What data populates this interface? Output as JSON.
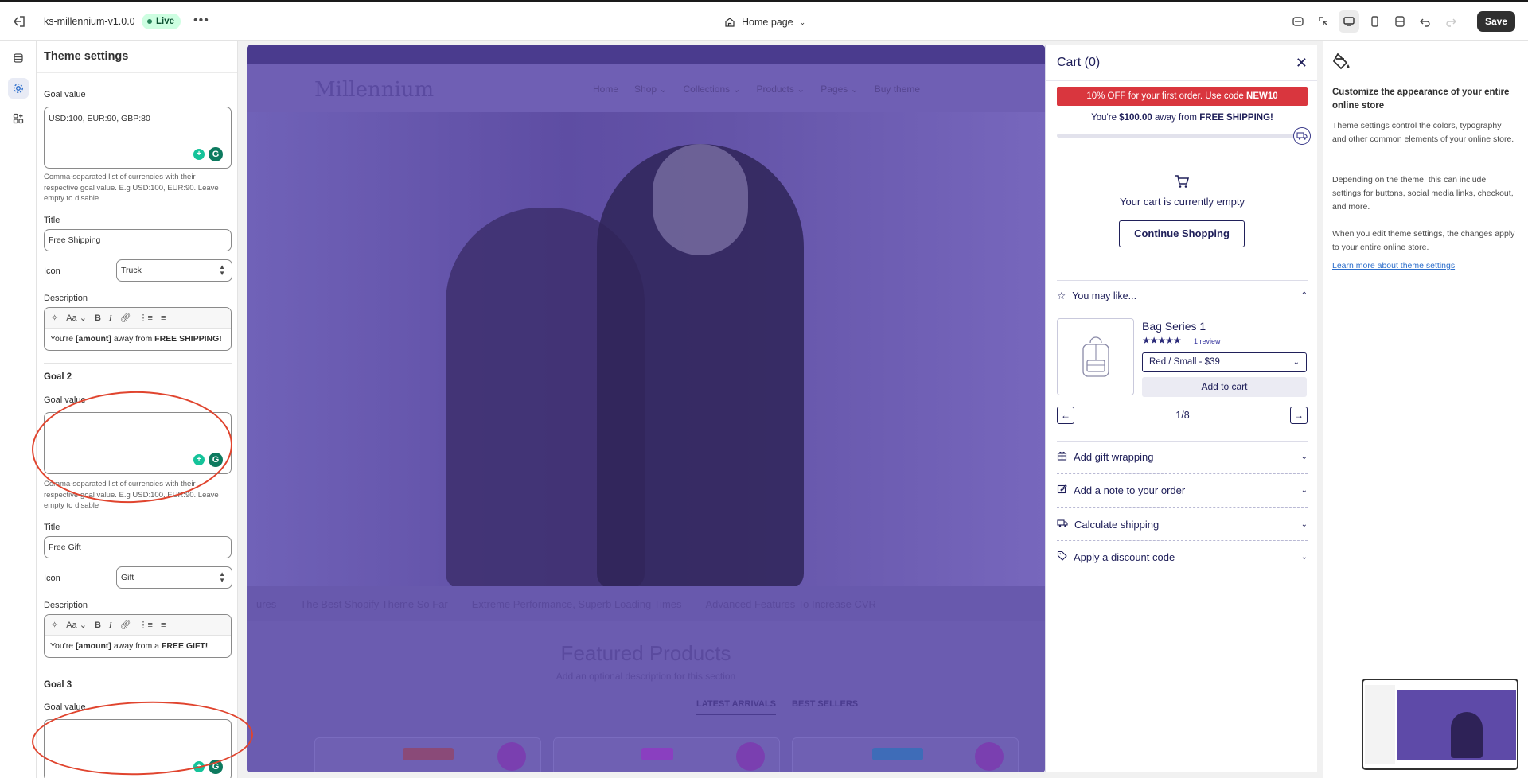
{
  "topbar": {
    "theme_name": "ks-millennium-v1.0.0",
    "status_badge": "Live",
    "page_selector": "Home page",
    "save_label": "Save"
  },
  "settings": {
    "title": "Theme settings",
    "goal_value_label": "Goal value",
    "goal1": {
      "goal_value": "USD:100, EUR:90, GBP:80",
      "help": "Comma-separated list of currencies with their respective goal value. E.g USD:100, EUR:90. Leave empty to disable",
      "title_label": "Title",
      "title_value": "Free Shipping",
      "icon_label": "Icon",
      "icon_value": "Truck",
      "description_label": "Description",
      "description_prefix": "You're ",
      "description_amount": "[amount]",
      "description_suffix": " away from ",
      "description_bold": "FREE SHIPPING!"
    },
    "goal2": {
      "heading": "Goal 2",
      "goal_value_label": "Goal value",
      "goal_value": "",
      "help": "Comma-separated list of currencies with their respective goal value. E.g USD:100, EUR:90. Leave empty to disable",
      "title_label": "Title",
      "title_value": "Free Gift",
      "icon_label": "Icon",
      "icon_value": "Gift",
      "description_label": "Description",
      "description_prefix": "You're ",
      "description_amount": "[amount]",
      "description_suffix": " away from a ",
      "description_bold": "FREE GIFT!"
    },
    "goal3": {
      "heading": "Goal 3",
      "goal_value_label": "Goal value",
      "goal_value": ""
    }
  },
  "preview": {
    "logo": "Millennium",
    "nav": [
      "Home",
      "Shop ⌄",
      "Collections ⌄",
      "Products ⌄",
      "Pages ⌄",
      "Buy theme"
    ],
    "marquee": [
      "ures",
      "The Best Shopify Theme So Far",
      "Extreme Performance, Superb Loading Times",
      "Advanced Features To Increase CVR"
    ],
    "featured_title": "Featured Products",
    "featured_sub": "Add an optional description for this section",
    "tabs": [
      "LATEST ARRIVALS",
      "BEST SELLERS"
    ]
  },
  "cart": {
    "title": "Cart (0)",
    "promo_text": "10% OFF for your first order. Use code ",
    "promo_code": "NEW10",
    "ship_prefix": "You're ",
    "ship_amount": "$100.00",
    "ship_middle": " away from ",
    "ship_goal": "FREE SHIPPING!",
    "progress": 0,
    "empty_text": "Your cart is currently empty",
    "continue_label": "Continue Shopping",
    "you_may_like": "You may like...",
    "product": {
      "name": "Bag Series 1",
      "stars": "★★★★★",
      "reviews": "1 review",
      "variant": "Red / Small - $39",
      "add_label": "Add to cart"
    },
    "pagination": "1/8",
    "accordions": [
      "Add gift wrapping",
      "Add a note to your order",
      "Calculate shipping",
      "Apply a discount code"
    ]
  },
  "info": {
    "heading": "Customize the appearance of your entire online store",
    "p1": "Theme settings control the colors, typography and other common elements of your online store.",
    "p2": "Depending on the theme, this can include settings for buttons, social media links, checkout, and more.",
    "p3": "When you edit theme settings, the changes apply to your entire online store.",
    "link": "Learn more about theme settings"
  },
  "colors": {
    "accent": "#2c6ecb",
    "promo": "#d9363e",
    "cart_text": "#20205a",
    "annotation": "#e0442e"
  }
}
